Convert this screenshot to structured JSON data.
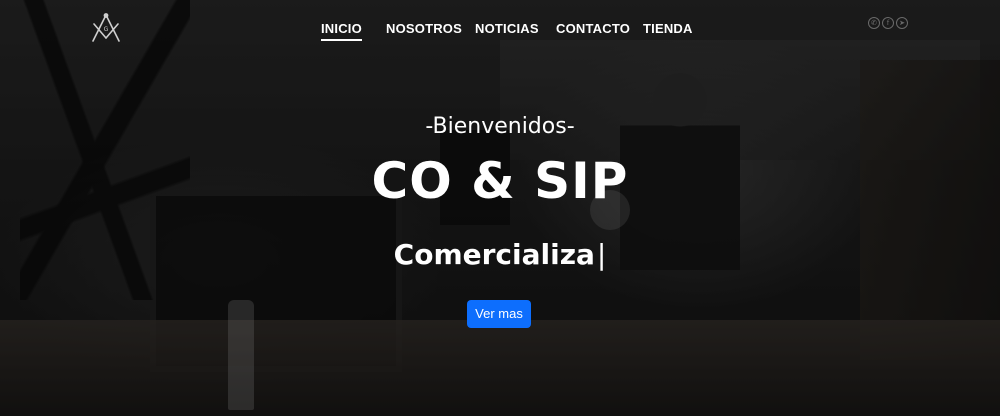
{
  "nav": {
    "items": [
      {
        "label": "INICIO",
        "active": true
      },
      {
        "label": "NOSOTROS",
        "active": false
      },
      {
        "label": "NOTICIAS",
        "active": false
      },
      {
        "label": "CONTACTO",
        "active": false
      },
      {
        "label": "TIENDA",
        "active": false
      }
    ],
    "logo_icon": "square-and-compass-icon",
    "social_icons": [
      "whatsapp-icon",
      "facebook-icon",
      "telegram-icon"
    ]
  },
  "hero": {
    "welcome": "-Bienvenidos-",
    "brand": "CO & SIP",
    "typed_text": "Comercializa",
    "cursor": "|",
    "button_label": "Ver mas"
  },
  "colors": {
    "button": "#0d6efd",
    "text": "#ffffff"
  }
}
